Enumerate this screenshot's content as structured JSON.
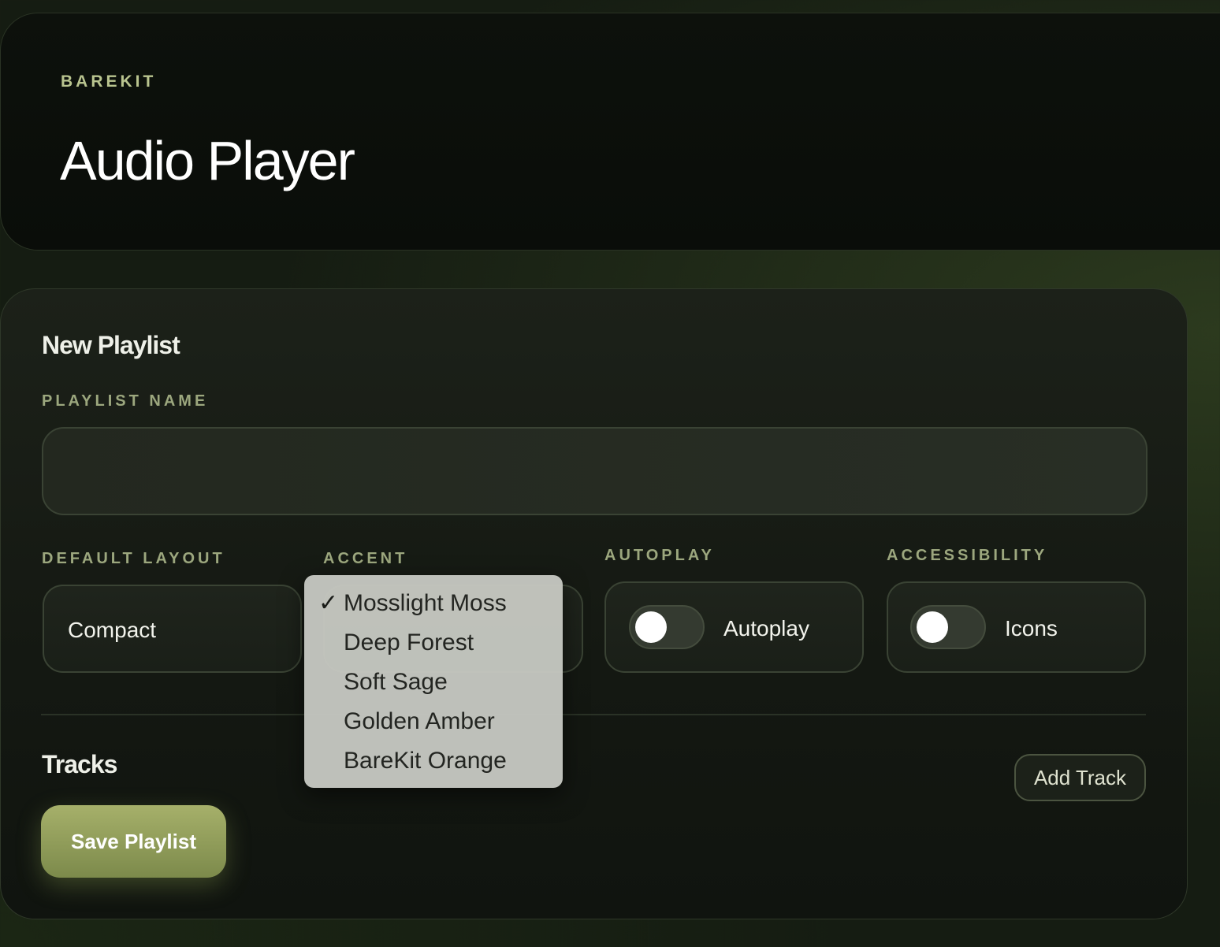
{
  "header": {
    "brand": "BAREKIT",
    "title": "Audio Player"
  },
  "form": {
    "section_title": "New Playlist",
    "playlist_name": {
      "label": "PLAYLIST NAME",
      "value": "",
      "placeholder": ""
    },
    "default_layout": {
      "label": "DEFAULT LAYOUT",
      "value": "Compact"
    },
    "accent": {
      "label": "ACCENT",
      "options": [
        "Mosslight Moss",
        "Deep Forest",
        "Soft Sage",
        "Golden Amber",
        "BareKit Orange"
      ],
      "selected": "Mosslight Moss",
      "check_glyph": "✓"
    },
    "autoplay": {
      "label": "AUTOPLAY",
      "toggle_label": "Autoplay",
      "enabled": false
    },
    "accessibility": {
      "label": "ACCESSIBILITY",
      "toggle_label": "Icons",
      "enabled": false
    }
  },
  "tracks": {
    "title": "Tracks",
    "add_label": "Add Track"
  },
  "actions": {
    "save_label": "Save Playlist"
  },
  "colors": {
    "accent": "#a6b06a",
    "label": "#9ca77e",
    "brand": "#b9c48f"
  }
}
